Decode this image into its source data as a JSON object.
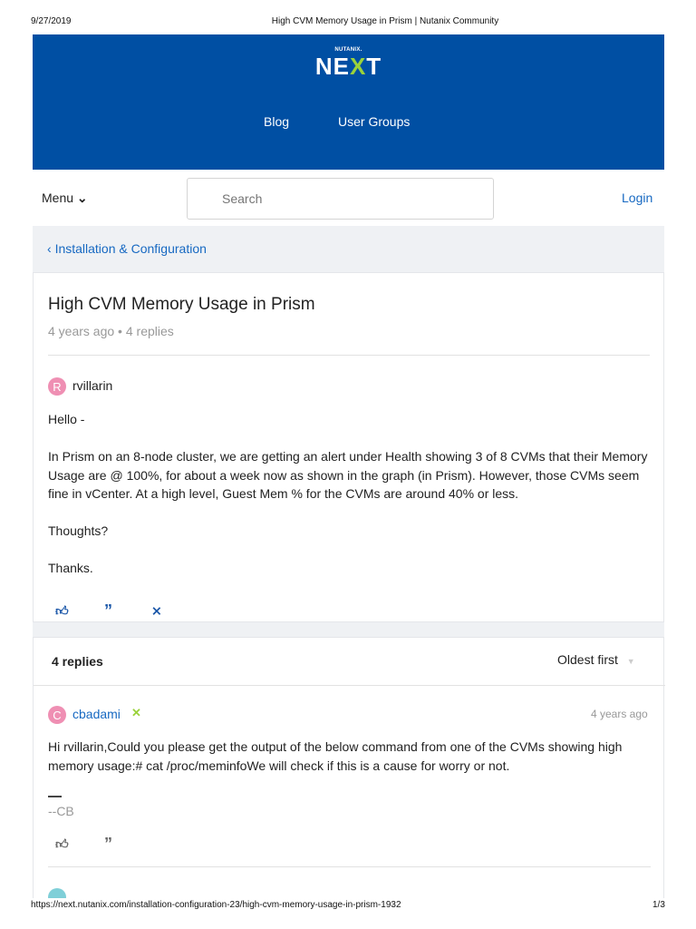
{
  "print_header": {
    "date": "9/27/2019",
    "title": "High CVM Memory Usage in Prism | Nutanix Community"
  },
  "brand": {
    "small": "NUTANIX.",
    "logo_a": "NE",
    "logo_x": "X",
    "logo_b": "T",
    "colors": {
      "header": "#004fa3",
      "accent": "#9ad23b",
      "link": "#1769c2"
    }
  },
  "nav": {
    "items": [
      "Blog",
      "User Groups"
    ]
  },
  "toolbar": {
    "menu": "Menu",
    "search_placeholder": "Search",
    "login": "Login"
  },
  "breadcrumb": {
    "label": "Installation & Configuration"
  },
  "post": {
    "title": "High CVM Memory Usage in Prism",
    "age": "4 years ago",
    "replies": "4 replies",
    "author_initial": "R",
    "author": "rvillarin",
    "paragraphs": [
      "Hello -",
      "In Prism on an 8-node cluster, we are getting an alert under Health showing 3 of 8 CVMs that their Memory Usage are @ 100%, for about a week now as shown in the graph (in Prism). However, those CVMs seem fine in vCenter. At a high level, Guest Mem % for the CVMs are around 40% or less.",
      "Thoughts?",
      "Thanks."
    ]
  },
  "replies": {
    "count_label": "4 replies",
    "sort": "Oldest first",
    "items": [
      {
        "author_initial": "C",
        "author": "cbadami",
        "time": "4 years ago",
        "body": "Hi rvillarin,Could you please get the output of the below command from one of the CVMs showing high memory usage:# cat /proc/meminfoWe will check if this is a cause for worry or not.",
        "signature": "--CB"
      }
    ]
  },
  "print_footer": {
    "url": "https://next.nutanix.com/installation-configuration-23/high-cvm-memory-usage-in-prism-1932",
    "page": "1/3"
  }
}
